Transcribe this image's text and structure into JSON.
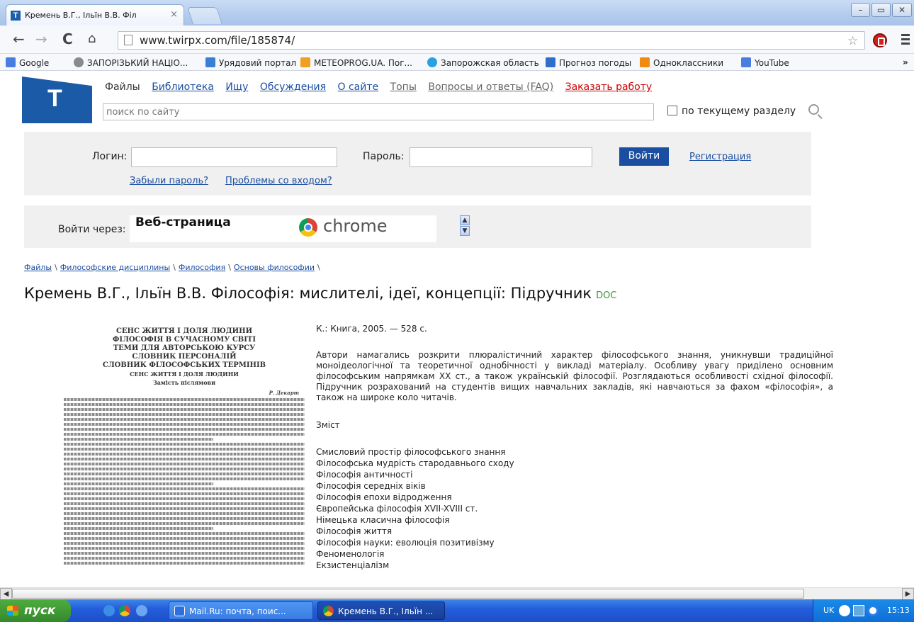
{
  "browser": {
    "tab_title": "Кремень В.Г., Ільїн В.В. Філ",
    "tab_close": "×",
    "url": "www.twirpx.com/file/185874/",
    "bookmarks": [
      "Google",
      "ЗАПОРІЗЬКИЙ НАЦІО...",
      "Урядовий портал",
      "METEOPROG.UA. Пог...",
      "Запорожская область",
      "Прогноз погоды",
      "Одноклассники",
      "YouTube"
    ],
    "bookmarks_more": "»"
  },
  "site": {
    "logo_letter": "T",
    "nav": [
      "Файлы",
      "Библиотека",
      "Ищу",
      "Обсуждения",
      "О сайте",
      "Топы",
      "Вопросы и ответы (FAQ)",
      "Заказать работу"
    ],
    "search_placeholder": "поиск по сайту",
    "search_scope_label": "по текущему разделу",
    "login_label": "Логин:",
    "password_label": "Пароль:",
    "login_button": "Войти",
    "register_link": "Регистрация",
    "forgot_link": "Забыли пароль?",
    "problems_link": "Проблемы со входом?",
    "login_via_label": "Войти через:",
    "login_via_option1": "Веб-страница",
    "login_via_option2": "chrome"
  },
  "page": {
    "breadcrumbs": [
      "Файлы",
      "Философские дисциплины",
      "Философия",
      "Основы философии"
    ],
    "title": "Кремень В.Г., Ільїн В.В. Філософія: мислителі, ідеї, концепції: Підручник",
    "format": "DOC",
    "publication": "К.: Книга, 2005. — 528 с.",
    "description": "Автори намагались розкрити плюралістичний характер філософського знання, уникнувши традиційної моноідеологічної та теоретичної однобічності у викладі матеріалу. Особливу увагу приділено основним філософським напрямкам XX ст., а також українській філософії. Розглядаються особливості східної філософії. Підручник розрахований на студентів вищих навчальних закладів, які навчаються за фахом «філософія», а також на широке коло читачів.",
    "contents_heading": "Зміст",
    "contents": [
      "Смисловий простір філософського знання",
      "Філософська мудрість стародавнього сходу",
      "Філософія античності",
      "Філософія середніх віків",
      "Філософія епохи відродження",
      "Європейська філософія XVII-XVIII ст.",
      "Німецька класична філософія",
      "Філософія життя",
      "Філософія науки: еволюція позитивізму",
      "Феноменологія",
      "Екзистенціалізм"
    ],
    "preview": {
      "heading_lines": [
        "СЕНС ЖИТТЯ І ДОЛЯ ЛЮДИНИ",
        "ФІЛОСОФІЯ В СУЧАСНОМУ СВІТІ",
        "ТЕМИ ДЛЯ АВТОРСЬКОЮ КУРСУ",
        "СЛОВНИК ПЕРСОНАЛІЙ",
        "СЛОВНИК ФІЛОСОФСЬКИХ ТЕРМІНІВ",
        "СЕНС ЖИТТЯ І ДОЛЯ ЛЮДИНИ",
        "Замість післямови"
      ],
      "epigraph_author": "Р. Декарт"
    }
  },
  "taskbar": {
    "start_label": "пуск",
    "tasks": [
      "Mail.Ru: почта, поис...",
      "Кремень В.Г., Ільїн ..."
    ],
    "lang": "UK",
    "clock": "15:13"
  },
  "colors": {
    "accent": "#1a4ea0",
    "logo": "#1a5aa6",
    "order_link": "#cc0000",
    "doc_badge": "#3a9a3a"
  }
}
